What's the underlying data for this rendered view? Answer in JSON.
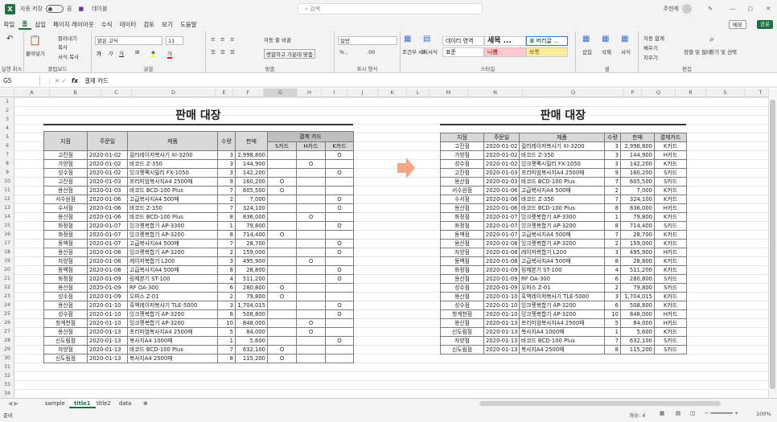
{
  "titlebar": {
    "autosave": "자동 저장",
    "autosave_state": "끔",
    "filename": "데이블",
    "search": "검색",
    "user": "주현제"
  },
  "menu": [
    "파일",
    "홈",
    "삽입",
    "페이지 레이아웃",
    "수식",
    "데이터",
    "검토",
    "보기",
    "도움말"
  ],
  "menu_active": "홈",
  "memo": "메모",
  "share": "공유",
  "ribbon": {
    "undo": "실행 취소",
    "clipboard": "클립보드",
    "paste": "붙여넣기",
    "cut": "잘라내기",
    "copy": "복사",
    "format_painter": "서식 복사",
    "font_group": "글꼴",
    "font_name": "맑은 고딕",
    "font_size": "11",
    "align_group": "맞춤",
    "wrap": "자동 줄 바꿈",
    "merge": "병합하고 가운데 맞춤",
    "number_group": "표시 형식",
    "number_format": "일반",
    "style_group": "스타일",
    "cond_format": "조건부 서식",
    "table_format": "표 서식",
    "style1": "데이터 영역",
    "style2": "세목 ...",
    "style3": "표 머리글 ...",
    "style4": "표준",
    "style5": "나쁨",
    "style6": "보통",
    "cells_group": "셀",
    "insert": "삽입",
    "delete": "삭제",
    "format": "서식",
    "edit_group": "편집",
    "autosum": "자동 합계",
    "fill": "채우기",
    "clear": "지우기",
    "sort": "정렬 및 필터",
    "find": "찾기 및 선택"
  },
  "formula": {
    "cell": "G5",
    "content": "결제 카드"
  },
  "columns": [
    "A",
    "B",
    "C",
    "D",
    "E",
    "F",
    "G",
    "H",
    "I",
    "J",
    "K",
    "L",
    "M",
    "N",
    "O",
    "P",
    "Q",
    "R",
    "S",
    "T",
    "U"
  ],
  "rows": [
    "1",
    "2",
    "3",
    "4",
    "5",
    "6",
    "7",
    "8",
    "9",
    "10",
    "11",
    "12",
    "13",
    "14",
    "15",
    "16",
    "17",
    "18",
    "19",
    "20",
    "21",
    "22",
    "23",
    "24",
    "25",
    "26",
    "27",
    "28",
    "29",
    "30",
    "31",
    "32",
    "33",
    "34"
  ],
  "left": {
    "title": "판매 대장",
    "headers": [
      "지점",
      "주문일",
      "제품",
      "수량",
      "판매",
      "결제 카드"
    ],
    "subheaders": [
      "S카드",
      "H카드",
      "K카드"
    ],
    "rows": [
      [
        "고잔점",
        "2020-01-02",
        "컬러레이저복사기 XI-3200",
        "3",
        "2,998,800",
        "",
        "",
        "O"
      ],
      [
        "가양점",
        "2020-01-02",
        "바코드 Z-350",
        "3",
        "144,900",
        "",
        "O",
        ""
      ],
      [
        "성수점",
        "2020-01-02",
        "잉크젯팩시밀리 FX-1050",
        "3",
        "142,200",
        "",
        "",
        "O"
      ],
      [
        "고잔점",
        "2020-01-03",
        "프리미엄복사지A4 2500매",
        "9",
        "160,200",
        "O",
        "",
        ""
      ],
      [
        "용산점",
        "2020-01-03",
        "바코드 BCD-100 Plus",
        "7",
        "605,500",
        "O",
        "",
        ""
      ],
      [
        "서수원점",
        "2020-01-06",
        "고급복사지A4 500매",
        "2",
        "7,000",
        "",
        "",
        "O"
      ],
      [
        "수서점",
        "2020-01-06",
        "바코드 Z-350",
        "7",
        "324,100",
        "",
        "",
        "O"
      ],
      [
        "용산점",
        "2020-01-06",
        "바코드 BCD-100 Plus",
        "8",
        "836,000",
        "",
        "O",
        ""
      ],
      [
        "화정점",
        "2020-01-07",
        "잉크젯복합기 AP-3300",
        "1",
        "79,800",
        "",
        "",
        "O"
      ],
      [
        "화정점",
        "2020-01-07",
        "잉크젯복합기 AP-3200",
        "8",
        "714,400",
        "O",
        "",
        ""
      ],
      [
        "동백점",
        "2020-01-07",
        "고급복사지A4 500매",
        "7",
        "28,700",
        "",
        "",
        "O"
      ],
      [
        "용산점",
        "2020-01-08",
        "잉크젯복합기 AP-3200",
        "2",
        "159,000",
        "",
        "",
        "O"
      ],
      [
        "자양점",
        "2020-01-08",
        "레이저복합기 L200",
        "3",
        "495,900",
        "",
        "O",
        ""
      ],
      [
        "동백점",
        "2020-01-08",
        "고급복사지A4 500매",
        "8",
        "28,800",
        "",
        "",
        "O"
      ],
      [
        "화정점",
        "2020-01-09",
        "링제본기 ST-100",
        "4",
        "511,200",
        "",
        "",
        "O"
      ],
      [
        "용산점",
        "2020-01-09",
        "RF OA-300",
        "6",
        "280,800",
        "O",
        "",
        ""
      ],
      [
        "성수점",
        "2020-01-09",
        "오피스 Z-01",
        "2",
        "79,800",
        "O",
        "",
        ""
      ],
      [
        "용산점",
        "2020-01-10",
        "흑백레이저복사기 TLE-5000",
        "3",
        "1,704,015",
        "",
        "",
        "O"
      ],
      [
        "성수점",
        "2020-01-10",
        "잉크젯복합기 AP-3200",
        "6",
        "508,800",
        "",
        "",
        "O"
      ],
      [
        "청계천점",
        "2020-01-10",
        "잉크젯복합기 AP-3200",
        "10",
        "848,000",
        "",
        "O",
        ""
      ],
      [
        "용산점",
        "2020-01-13",
        "프리미엄복사지A4 2500매",
        "5",
        "84,000",
        "",
        "O",
        ""
      ],
      [
        "신도림점",
        "2020-01-13",
        "복사지A4 1000매",
        "1",
        "5,600",
        "",
        "",
        "O"
      ],
      [
        "자양점",
        "2020-01-13",
        "바코드 BCD-100 Plus",
        "7",
        "632,100",
        "O",
        "",
        ""
      ],
      [
        "신도림점",
        "2020-01-13",
        "복사지A4 2500매",
        "8",
        "115,200",
        "O",
        "",
        ""
      ]
    ]
  },
  "right": {
    "title": "판매 대장",
    "headers": [
      "지점",
      "주문일",
      "제품",
      "수량",
      "판매",
      "결제카드"
    ],
    "rows": [
      [
        "고잔점",
        "2020-01-02",
        "컬러레이저복사기 XI-3200",
        "3",
        "2,998,800",
        "K카드"
      ],
      [
        "가양점",
        "2020-01-02",
        "바코드 Z-350",
        "3",
        "144,900",
        "H카드"
      ],
      [
        "성수점",
        "2020-01-02",
        "잉크젯팩시밀리 FX-1050",
        "3",
        "142,200",
        "K카드"
      ],
      [
        "고잔점",
        "2020-01-03",
        "프리미엄복사지A4 2500매",
        "9",
        "160,200",
        "S카드"
      ],
      [
        "용산점",
        "2020-01-03",
        "바코드 BCD-100 Plus",
        "7",
        "605,500",
        "S카드"
      ],
      [
        "서수원점",
        "2020-01-06",
        "고급복사지A4 500매",
        "2",
        "7,000",
        "K카드"
      ],
      [
        "수서점",
        "2020-01-06",
        "바코드 Z-350",
        "7",
        "324,100",
        "K카드"
      ],
      [
        "용산점",
        "2020-01-06",
        "바코드 BCD-100 Plus",
        "8",
        "836,000",
        "H카드"
      ],
      [
        "화정점",
        "2020-01-07",
        "잉크젯복합기 AP-3300",
        "1",
        "79,800",
        "K카드"
      ],
      [
        "화정점",
        "2020-01-07",
        "잉크젯복합기 AP-3200",
        "8",
        "714,400",
        "S카드"
      ],
      [
        "동백점",
        "2020-01-07",
        "고급복사지A4 500매",
        "7",
        "28,700",
        "K카드"
      ],
      [
        "용산점",
        "2020-01-08",
        "잉크젯복합기 AP-3200",
        "2",
        "159,000",
        "K카드"
      ],
      [
        "자양점",
        "2020-01-08",
        "레이저복합기 L200",
        "3",
        "495,900",
        "H카드"
      ],
      [
        "동백점",
        "2020-01-08",
        "고급복사지A4 500매",
        "8",
        "28,800",
        "K카드"
      ],
      [
        "화정점",
        "2020-01-09",
        "링제본기 ST-100",
        "4",
        "511,200",
        "K카드"
      ],
      [
        "용산점",
        "2020-01-09",
        "RF OA-300",
        "6",
        "280,800",
        "S카드"
      ],
      [
        "성수점",
        "2020-01-09",
        "오피스 Z-01",
        "2",
        "79,800",
        "S카드"
      ],
      [
        "용산점",
        "2020-01-10",
        "흑백레이저복사기 TLE-5000",
        "3",
        "1,704,015",
        "K카드"
      ],
      [
        "성수점",
        "2020-01-10",
        "잉크젯복합기 AP-3200",
        "6",
        "508,800",
        "K카드"
      ],
      [
        "청계천점",
        "2020-01-10",
        "잉크젯복합기 AP-3200",
        "10",
        "848,000",
        "H카드"
      ],
      [
        "용산점",
        "2020-01-13",
        "프리미엄복사지A4 2500매",
        "5",
        "84,000",
        "H카드"
      ],
      [
        "신도림점",
        "2020-01-13",
        "복사지A4 1000매",
        "1",
        "5,600",
        "K카드"
      ],
      [
        "자양점",
        "2020-01-13",
        "바코드 BCD-100 Plus",
        "7",
        "632,100",
        "S카드"
      ],
      [
        "신도림점",
        "2020-01-13",
        "복사지A4 2500매",
        "8",
        "115,200",
        "S카드"
      ]
    ]
  },
  "tabs": [
    "sample",
    "title1",
    "title2",
    "data"
  ],
  "tab_active": "title1",
  "status": {
    "ready": "준비",
    "count": "개수: 4",
    "zoom": "100%"
  },
  "colors": {
    "accent": "#1e7145",
    "arrow": "#f4a582",
    "bad": "#ffc7ce",
    "neutral": "#ffeb9c"
  }
}
